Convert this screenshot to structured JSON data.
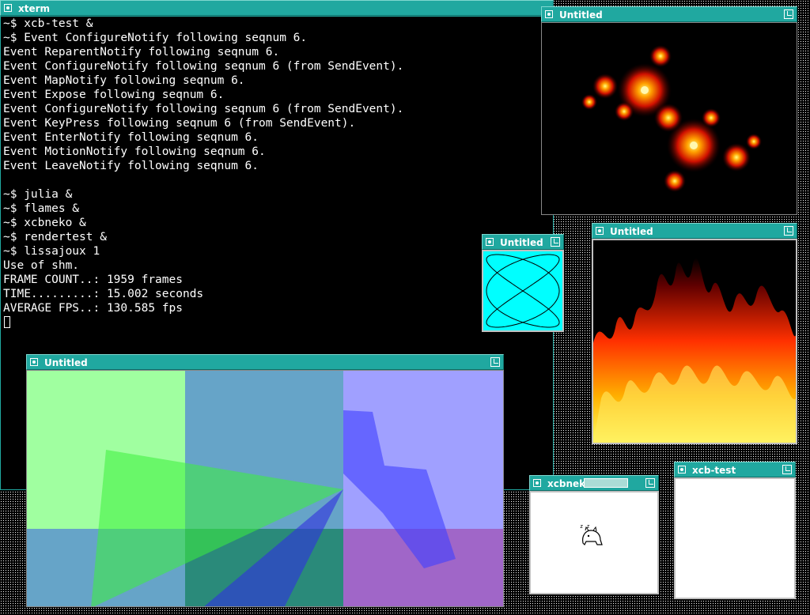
{
  "xterm": {
    "title": "xterm",
    "lines": [
      "~$ xcb-test &",
      "~$ Event ConfigureNotify following seqnum 6.",
      "Event ReparentNotify following seqnum 6.",
      "Event ConfigureNotify following seqnum 6 (from SendEvent).",
      "Event MapNotify following seqnum 6.",
      "Event Expose following seqnum 6.",
      "Event ConfigureNotify following seqnum 6 (from SendEvent).",
      "Event KeyPress following seqnum 6 (from SendEvent).",
      "Event EnterNotify following seqnum 6.",
      "Event MotionNotify following seqnum 6.",
      "Event LeaveNotify following seqnum 6.",
      "",
      "~$ julia &",
      "~$ flames &",
      "~$ xcbneko &",
      "~$ rendertest &",
      "~$ lissajoux 1",
      "Use of shm.",
      "FRAME COUNT..: 1959 frames",
      "TIME.........: 15.002 seconds",
      "AVERAGE FPS..: 130.585 fps"
    ]
  },
  "julia_window": {
    "title": "Untitled"
  },
  "lissajous_window": {
    "title": "Untitled"
  },
  "flames_window": {
    "title": "Untitled"
  },
  "rendertest_window": {
    "title": "Untitled"
  },
  "neko_window": {
    "title": "xcbneko"
  },
  "xcbtest_window": {
    "title": "xcb-test"
  },
  "colors": {
    "titlebar": "#20a8a0",
    "lissajous_bg": "#00ffff",
    "terminal_bg": "#000000",
    "terminal_fg": "#ffffff"
  }
}
